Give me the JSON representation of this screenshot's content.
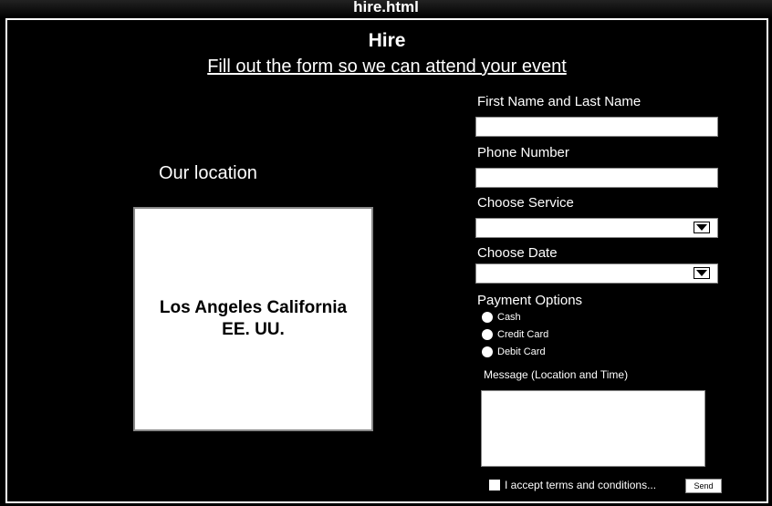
{
  "window": {
    "title": "hire.html"
  },
  "page": {
    "title": "Hire",
    "subtitle": "Fill out the form so we can attend your event"
  },
  "location": {
    "heading": "Our location",
    "map_line1": "Los Angeles California",
    "map_line2": "EE. UU."
  },
  "form": {
    "name_label": "First Name and Last Name",
    "name_value": "",
    "phone_label": "Phone Number",
    "phone_value": "",
    "service_label": "Choose Service",
    "service_value": "",
    "date_label": "Choose Date",
    "date_value": "",
    "payment_label": "Payment Options",
    "payment_options": [
      "Cash",
      "Credit Card",
      "Debit Card"
    ],
    "message_label": "Message (Location and Time)",
    "message_value": "",
    "terms_label": "I accept terms and conditions...",
    "send_label": "Send"
  },
  "icons": {
    "dropdown": "chevron-down-icon"
  }
}
